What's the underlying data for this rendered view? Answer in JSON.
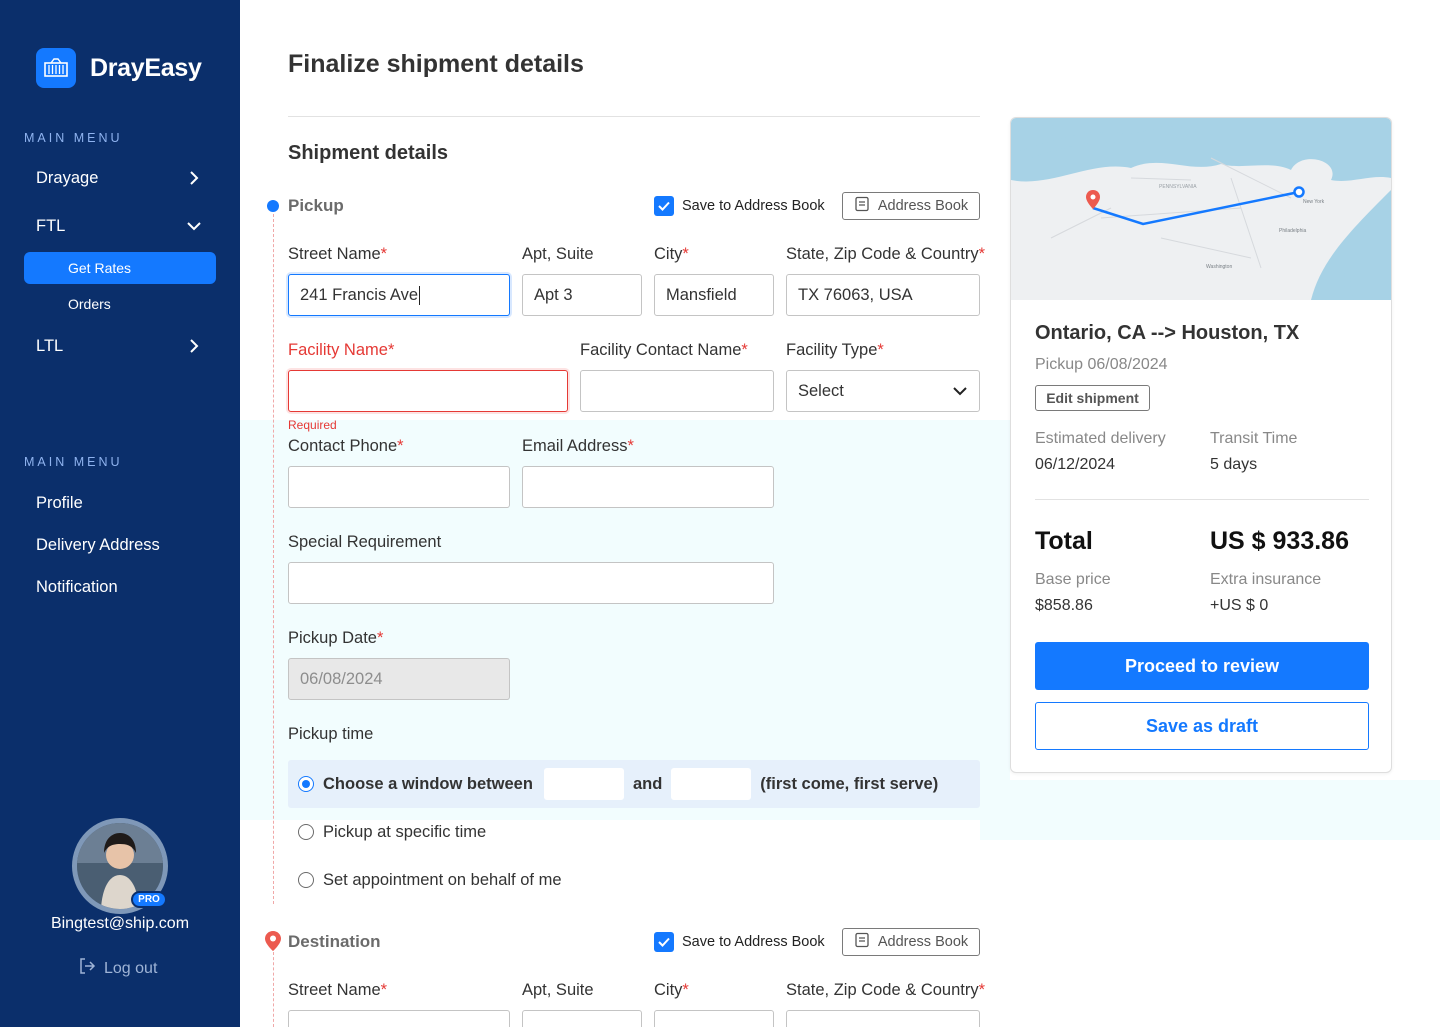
{
  "brand": {
    "name": "DrayEasy",
    "logo_icon": "container-icon"
  },
  "sidebar": {
    "main_menu_heading": "MAIN MENU",
    "items": [
      {
        "label": "Drayage"
      },
      {
        "label": "FTL"
      },
      {
        "label": "LTL"
      }
    ],
    "ftl_subitems": [
      {
        "label": "Get Rates",
        "active": true
      },
      {
        "label": "Orders",
        "active": false
      }
    ],
    "account_heading": "MAIN MENU",
    "account_items": [
      {
        "label": "Profile"
      },
      {
        "label": "Delivery Address"
      },
      {
        "label": "Notification"
      }
    ],
    "profile": {
      "email": "Bingtest@ship.com",
      "badge": "PRO"
    },
    "logout_label": "Log out"
  },
  "main": {
    "page_title": "Finalize shipment details",
    "section_title": "Shipment details",
    "pickup": {
      "label": "Pickup",
      "save_to_address_book": "Save to Address Book",
      "save_checked": true,
      "address_book_button": "Address Book",
      "street_label": "Street Name",
      "street_value": "241 Francis Ave",
      "apt_label": "Apt, Suite",
      "apt_value": "Apt 3",
      "city_label": "City",
      "city_value": "Mansfield",
      "state_label": "State, Zip Code & Country",
      "state_value": "TX 76063, USA",
      "facility_label": "Facility Name",
      "facility_value": "",
      "facility_error": "Required",
      "facility_contact_label": "Facility Contact Name",
      "facility_contact_value": "",
      "facility_type_label": "Facility Type",
      "facility_type_value": "Select",
      "phone_label": "Contact Phone",
      "email_label": "Email Address",
      "special_label": "Special Requirement",
      "date_label": "Pickup Date",
      "date_value": "06/08/2024",
      "time_label": "Pickup time",
      "time_options": {
        "window_prefix": "Choose a window between",
        "window_and": "and",
        "window_suffix": "(first come, first serve)",
        "specific": "Pickup at specific time",
        "appointment": "Set appointment on behalf of me"
      },
      "selected_time_option": "window"
    },
    "destination": {
      "label": "Destination",
      "save_to_address_book": "Save to Address Book",
      "save_checked": true,
      "address_book_button": "Address Book",
      "street_label": "Street Name",
      "apt_label": "Apt, Suite",
      "city_label": "City",
      "state_label": "State, Zip Code & Country"
    },
    "required_mark": "*"
  },
  "summary": {
    "map_labels": {
      "state": "PENNSYLVANIA",
      "city": "New York",
      "city2": "Philadelphia",
      "city3": "Washington"
    },
    "route": "Ontario, CA --> Houston, TX",
    "pickup_date": "Pickup 06/08/2024",
    "edit_button": "Edit shipment",
    "estimated_delivery_label": "Estimated delivery",
    "estimated_delivery_value": "06/12/2024",
    "transit_time_label": "Transit Time",
    "transit_time_value": "5 days",
    "total_label": "Total",
    "total_value": "US $ 933.86",
    "base_price_label": "Base price",
    "base_price_value": "$858.86",
    "extra_insurance_label": "Extra insurance",
    "extra_insurance_value": "+US $ 0",
    "proceed_button": "Proceed to review",
    "draft_button": "Save as draft"
  },
  "colors": {
    "sidebar_bg": "#0b2f6b",
    "accent": "#1479ff",
    "error": "#e53935",
    "mint_bg": "#f2fdfe"
  }
}
